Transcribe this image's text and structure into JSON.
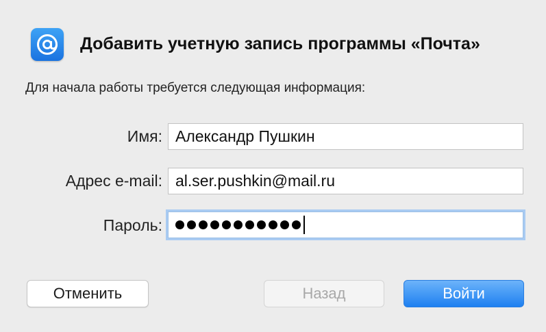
{
  "dialog": {
    "app_icon": "at-sign-icon",
    "title": "Добавить учетную запись программы «Почта»",
    "subtitle": "Для начала работы требуется следующая информация:"
  },
  "form": {
    "name_label": "Имя:",
    "name_value": "Александр Пушкин",
    "email_label": "Адрес e-mail:",
    "email_value": "al.ser.pushkin@mail.ru",
    "password_label": "Пароль:",
    "password_masked_length": 11
  },
  "buttons": {
    "cancel_label": "Отменить",
    "back_label": "Назад",
    "login_label": "Войти"
  },
  "colors": {
    "accent": "#1e80f0",
    "focus_ring": "#a9cbf2",
    "disabled_text": "#a8a8a8"
  }
}
